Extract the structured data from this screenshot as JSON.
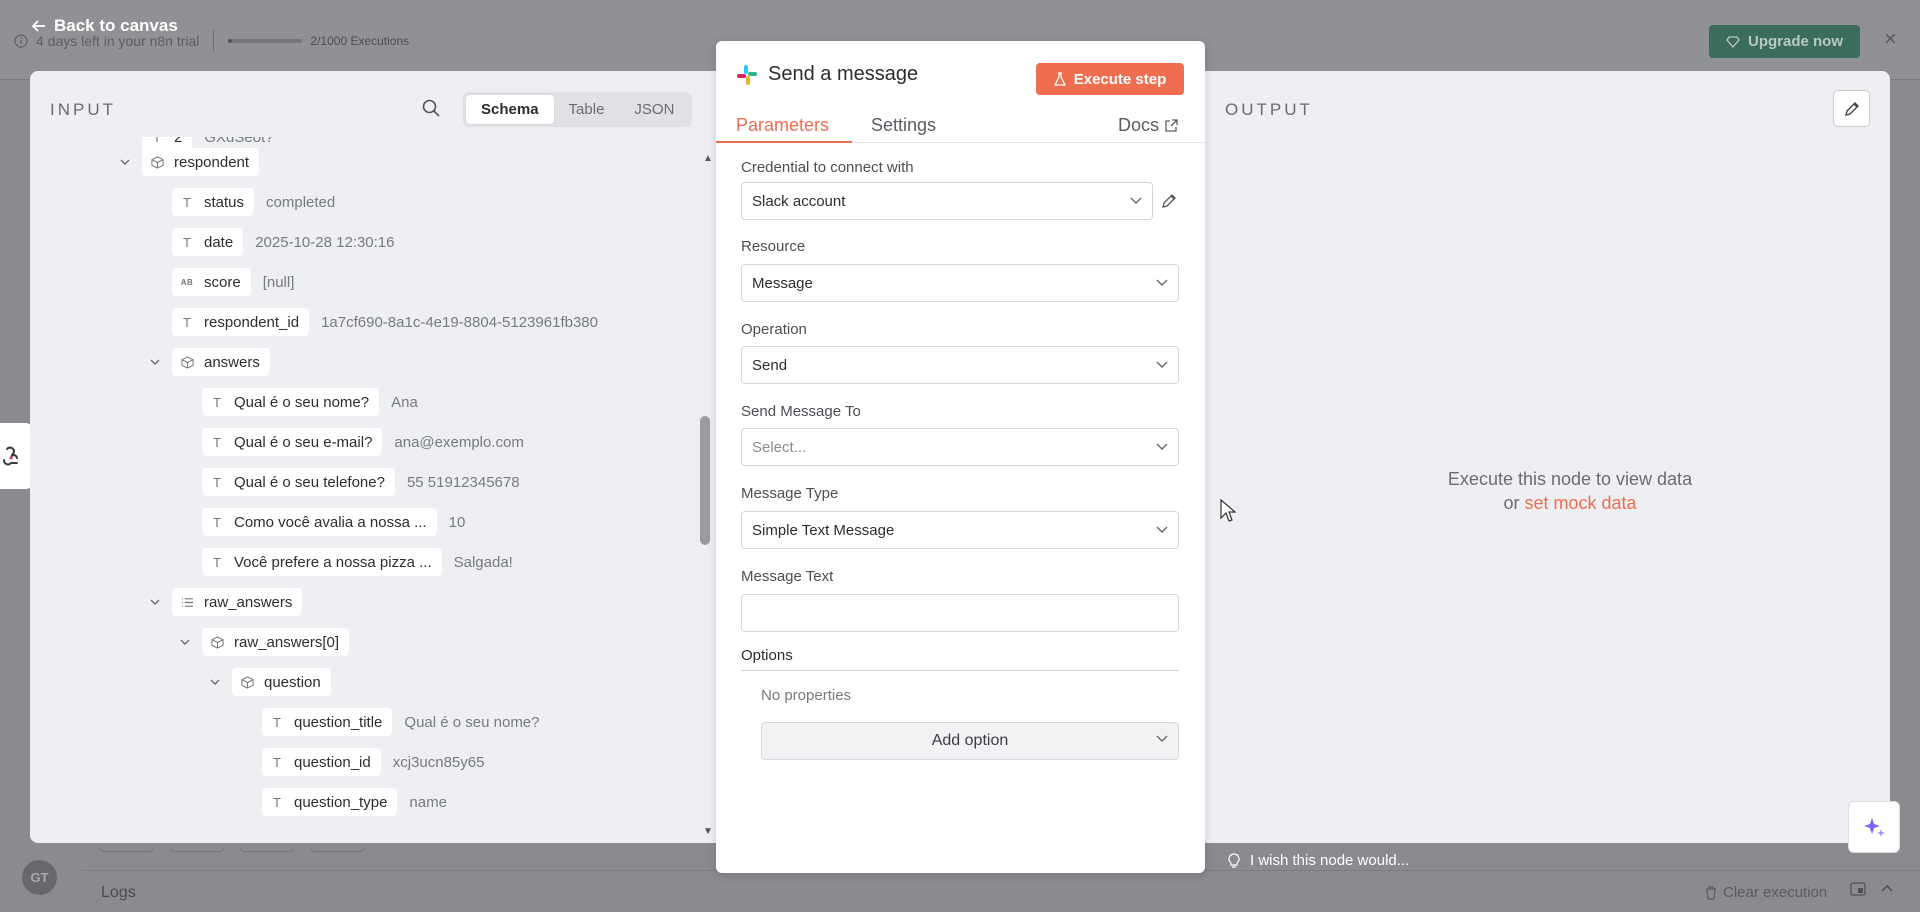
{
  "background": {
    "trial_text": "4 days left in your n8n trial",
    "executions": "2/1000 Executions",
    "upgrade_label": "Upgrade now",
    "back_label": "Back to canvas",
    "logs_label": "Logs",
    "clear_execution_label": "Clear execution",
    "avatar_initials": "GT",
    "colors": {
      "upgrade": "#3c6c5c",
      "accent": "#ee6e4f"
    }
  },
  "input_panel": {
    "label": "INPUT",
    "view_tabs": [
      {
        "label": "Schema",
        "active": true
      },
      {
        "label": "Table",
        "active": false
      },
      {
        "label": "JSON",
        "active": false
      }
    ],
    "truncated_top_value": "GXdSeot?",
    "tree": [
      {
        "key": "respondent",
        "type": "object",
        "expanded": true,
        "value": ""
      },
      {
        "key": "status",
        "type": "string",
        "value": "completed"
      },
      {
        "key": "date",
        "type": "string",
        "value": "2025-10-28 12:30:16"
      },
      {
        "key": "score",
        "type": "null",
        "value": "[null]"
      },
      {
        "key": "respondent_id",
        "type": "string",
        "value": "1a7cf690-8a1c-4e19-8804-5123961fb380"
      },
      {
        "key": "answers",
        "type": "object",
        "expanded": true,
        "value": ""
      },
      {
        "key": "Qual é o seu nome?",
        "type": "string",
        "value": "Ana"
      },
      {
        "key": "Qual é o seu e-mail?",
        "type": "string",
        "value": "ana@exemplo.com"
      },
      {
        "key": "Qual é o seu telefone?",
        "type": "string",
        "value": "55 51912345678"
      },
      {
        "key": "Como você avalia a nossa ...",
        "type": "string",
        "value": "10"
      },
      {
        "key": "Você prefere a nossa pizza ...",
        "type": "string",
        "value": "Salgada!"
      },
      {
        "key": "raw_answers",
        "type": "array",
        "expanded": true,
        "value": ""
      },
      {
        "key": "raw_answers[0]",
        "type": "object",
        "expanded": true,
        "value": ""
      },
      {
        "key": "question",
        "type": "object",
        "expanded": true,
        "value": ""
      },
      {
        "key": "question_title",
        "type": "string",
        "value": "Qual é o seu nome?"
      },
      {
        "key": "question_id",
        "type": "string",
        "value": "xcj3ucn85y65"
      },
      {
        "key": "question_type",
        "type": "string",
        "value": "name"
      }
    ]
  },
  "node": {
    "title": "Send a message",
    "execute_label": "Execute step",
    "tabs": [
      {
        "label": "Parameters",
        "active": true
      },
      {
        "label": "Settings",
        "active": false
      }
    ],
    "docs_label": "Docs",
    "credential": {
      "label": "Credential to connect with",
      "value": "Slack account"
    },
    "resource": {
      "label": "Resource",
      "value": "Message"
    },
    "operation": {
      "label": "Operation",
      "value": "Send"
    },
    "send_to": {
      "label": "Send Message To",
      "placeholder": "Select..."
    },
    "message_type": {
      "label": "Message Type",
      "value": "Simple Text Message"
    },
    "message_text": {
      "label": "Message Text",
      "value": ""
    },
    "options": {
      "label": "Options",
      "empty_text": "No properties",
      "add_label": "Add option"
    }
  },
  "output_panel": {
    "label": "OUTPUT",
    "empty_line1": "Execute this node to view data",
    "empty_or": "or",
    "mock_link": "set mock data"
  },
  "footer": {
    "wish_text": "I wish this node would..."
  }
}
